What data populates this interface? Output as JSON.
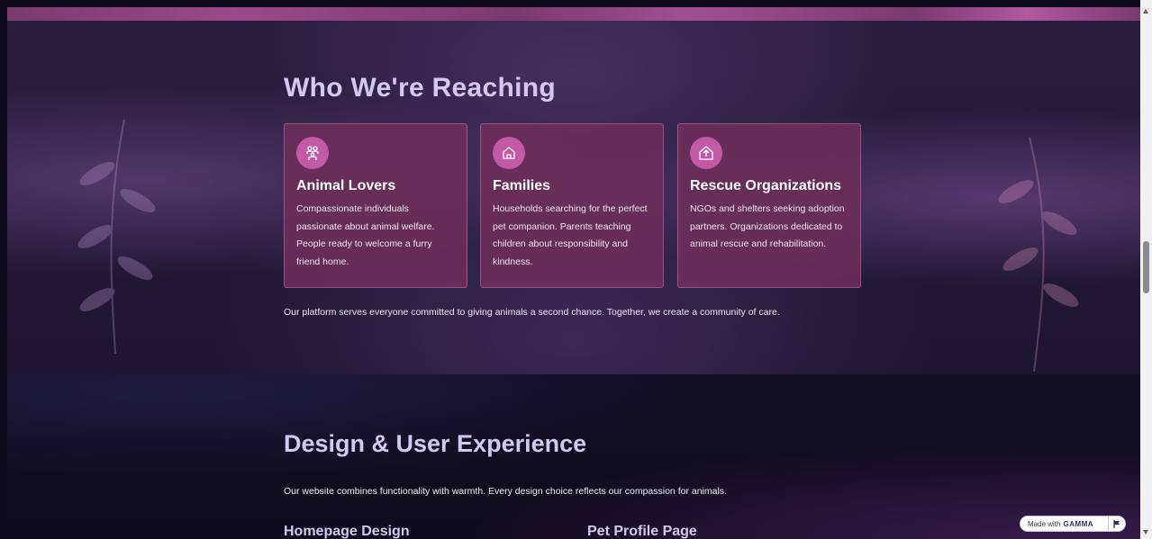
{
  "hero": {
    "title": "Who We're Reaching",
    "note": "Our platform serves everyone committed to giving animals a second chance. Together, we create a community of care.",
    "cards": [
      {
        "icon": "people-icon",
        "title": "Animal Lovers",
        "text": "Compassionate individuals passionate about animal welfare. People ready to welcome a furry friend home."
      },
      {
        "icon": "home-icon",
        "title": "Families",
        "text": "Households searching for the perfect pet companion. Parents teaching children about responsibility and kindness."
      },
      {
        "icon": "shelter-icon",
        "title": "Rescue Organizations",
        "text": "NGOs and shelters seeking adoption partners. Organizations dedicated to animal rescue and rehabilitation."
      }
    ]
  },
  "design": {
    "title": "Design & User Experience",
    "text": "Our website combines functionality with warmth. Every design choice reflects our compassion for animals.",
    "subheads": [
      "Homepage Design",
      "Pet Profile Page"
    ]
  },
  "badge": {
    "label": "Made with",
    "brand": "GAMMA"
  },
  "colors": {
    "card_bg": "#6e2d5a",
    "icon_bg": "#c25aa6",
    "heading": "#d2c8f0",
    "page_bg": "#0f0b1e"
  }
}
